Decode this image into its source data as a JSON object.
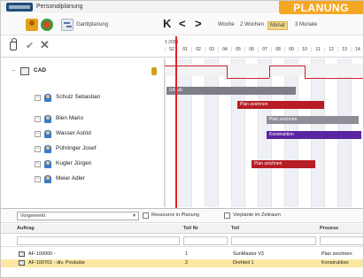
{
  "app": {
    "title": "Personalplanung"
  },
  "badge": {
    "label": "PLANUNG",
    "color": "#f5a623"
  },
  "toolbar": {
    "icons": [
      "person-add-icon",
      "resource-icon",
      "gantt-icon"
    ],
    "gantt_label": "Ganttplanung",
    "nav": {
      "first": "K",
      "prev": "<",
      "next": ">"
    },
    "ranges": [
      "Woche",
      "2 Wochen",
      "Monat",
      "3 Monate"
    ],
    "selected_range": "Monat"
  },
  "actions": {
    "icons": [
      "lock-icon",
      "check-icon",
      "close-icon"
    ]
  },
  "timeline": {
    "year_label": "1 2023",
    "weeks": [
      "52",
      "01",
      "02",
      "03",
      "04",
      "05",
      "06",
      "07",
      "08",
      "09",
      "10",
      "11",
      "12",
      "13",
      "14"
    ]
  },
  "tree": {
    "group": {
      "label": "CAD",
      "expander": "−"
    },
    "people": [
      {
        "name": "Schulz Sebastian"
      },
      {
        "name": "Bien Mario"
      },
      {
        "name": "Wasser Astrid"
      },
      {
        "name": "Pühringer Josef"
      },
      {
        "name": "Kugler Jürgen"
      },
      {
        "name": "Meier Adler"
      }
    ]
  },
  "gantt": {
    "bars": [
      {
        "row": 0,
        "label": "Urlaub",
        "color": "#7e7e86"
      },
      {
        "row": 1,
        "label": "Plan zeichnen",
        "color": "#b71d24"
      },
      {
        "row": 2,
        "label": "Plan zeichnen",
        "color": "#8e8e98"
      },
      {
        "row": 3,
        "label": "Konstruktion",
        "color": "#5a25a0"
      },
      {
        "row": 5,
        "label": "Plan zeichnen",
        "color": "#b71d24"
      }
    ]
  },
  "filters": {
    "select_value": "Vorgemerkt",
    "checkbox1_label": "Ressource in Planung",
    "checkbox2_label": "Vorplante im Zeitraum"
  },
  "table": {
    "columns": [
      "Auftrag",
      "Teil Nr",
      "Teil",
      "Prozess"
    ],
    "rows": [
      {
        "auftrag": "AF-100000 -",
        "teil_nr": "1",
        "teil": "SunMaster V3",
        "prozess": "Plan zeichnen",
        "highlight": false
      },
      {
        "auftrag": "AF-100701 - div. Produkte",
        "teil_nr": "2",
        "teil": "Drehteil 1",
        "prozess": "Konstruktion",
        "highlight": true
      }
    ]
  }
}
